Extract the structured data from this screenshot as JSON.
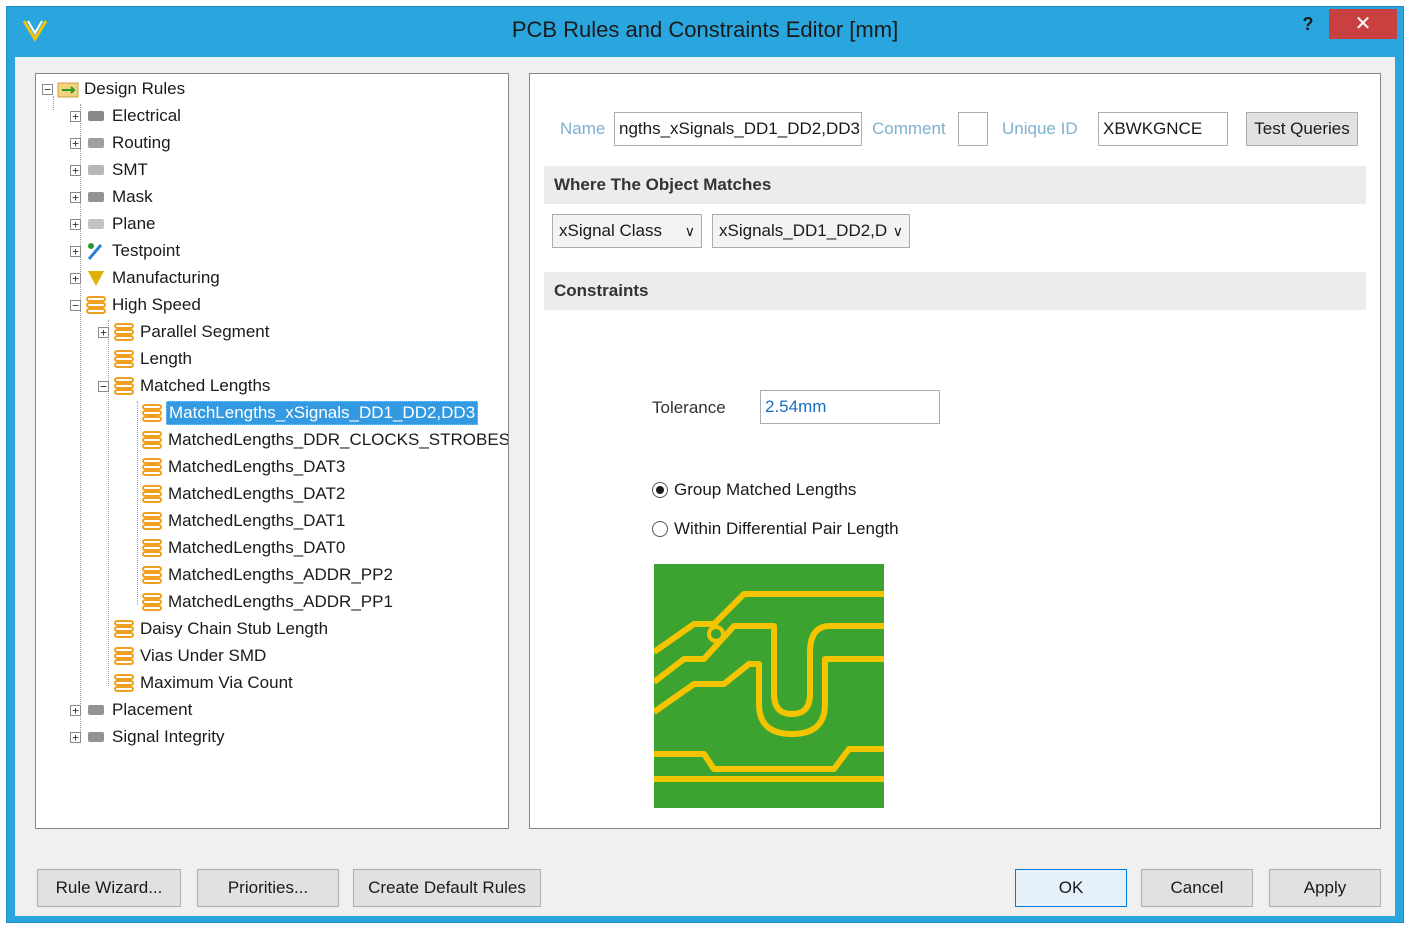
{
  "window": {
    "title": "PCB Rules and Constraints Editor [mm]",
    "help_label": "?",
    "close_label": "✕"
  },
  "tree": {
    "items": [
      {
        "label": "Design Rules",
        "icon": "design-rules-icon",
        "expander": "⊟"
      },
      {
        "label": "Electrical",
        "icon": "electrical-icon",
        "expander": "+"
      },
      {
        "label": "Routing",
        "icon": "routing-icon",
        "expander": "+"
      },
      {
        "label": "SMT",
        "icon": "smt-icon",
        "expander": "+"
      },
      {
        "label": "Mask",
        "icon": "mask-icon",
        "expander": "+"
      },
      {
        "label": "Plane",
        "icon": "plane-icon",
        "expander": "+"
      },
      {
        "label": "Testpoint",
        "icon": "testpoint-icon",
        "expander": "+"
      },
      {
        "label": "Manufacturing",
        "icon": "manufacturing-icon",
        "expander": "+"
      },
      {
        "label": "High Speed",
        "icon": "high-speed-icon",
        "expander": "−"
      },
      {
        "label": "Parallel Segment",
        "icon": "rule-icon",
        "expander": "+"
      },
      {
        "label": "Length",
        "icon": "rule-icon",
        "expander": ""
      },
      {
        "label": "Matched Lengths",
        "icon": "rule-icon",
        "expander": "−"
      },
      {
        "label": "MatchLengths_xSignals_DD1_DD2,DD3",
        "icon": "rule-icon",
        "expander": ""
      },
      {
        "label": "MatchedLengths_DDR_CLOCKS_STROBES",
        "icon": "rule-icon",
        "expander": ""
      },
      {
        "label": "MatchedLengths_DAT3",
        "icon": "rule-icon",
        "expander": ""
      },
      {
        "label": "MatchedLengths_DAT2",
        "icon": "rule-icon",
        "expander": ""
      },
      {
        "label": "MatchedLengths_DAT1",
        "icon": "rule-icon",
        "expander": ""
      },
      {
        "label": "MatchedLengths_DAT0",
        "icon": "rule-icon",
        "expander": ""
      },
      {
        "label": "MatchedLengths_ADDR_PP2",
        "icon": "rule-icon",
        "expander": ""
      },
      {
        "label": "MatchedLengths_ADDR_PP1",
        "icon": "rule-icon",
        "expander": ""
      },
      {
        "label": "Daisy Chain Stub Length",
        "icon": "rule-icon",
        "expander": ""
      },
      {
        "label": "Vias Under SMD",
        "icon": "rule-icon",
        "expander": ""
      },
      {
        "label": "Maximum Via Count",
        "icon": "rule-icon",
        "expander": ""
      },
      {
        "label": "Placement",
        "icon": "placement-icon",
        "expander": "+"
      },
      {
        "label": "Signal Integrity",
        "icon": "signal-integrity-icon",
        "expander": "+"
      }
    ]
  },
  "rule": {
    "name_label": "Name",
    "name_value": "ngths_xSignals_DD1_DD2,DD3",
    "comment_label": "Comment",
    "comment_value": "",
    "unique_id_label": "Unique ID",
    "unique_id_value": "XBWKGNCE",
    "test_queries_label": "Test Queries",
    "where_header": "Where The Object Matches",
    "query_type": "xSignal Class",
    "query_value": "xSignals_DD1_DD2,D",
    "constraints_header": "Constraints",
    "tolerance_label": "Tolerance",
    "tolerance_value": "2.54mm",
    "radio_group": "Group Matched Lengths",
    "radio_diff": "Within Differential Pair Length",
    "selected_radio": "Group Matched Lengths"
  },
  "buttons": {
    "rule_wizard": "Rule Wizard...",
    "priorities": "Priorities...",
    "create_default": "Create Default Rules",
    "ok": "OK",
    "cancel": "Cancel",
    "apply": "Apply"
  },
  "colors": {
    "title_bar": "#2aa6df",
    "close": "#c94040",
    "selection": "#3399e0",
    "pcb_green": "#3ca330",
    "pcb_trace": "#f5c400"
  }
}
